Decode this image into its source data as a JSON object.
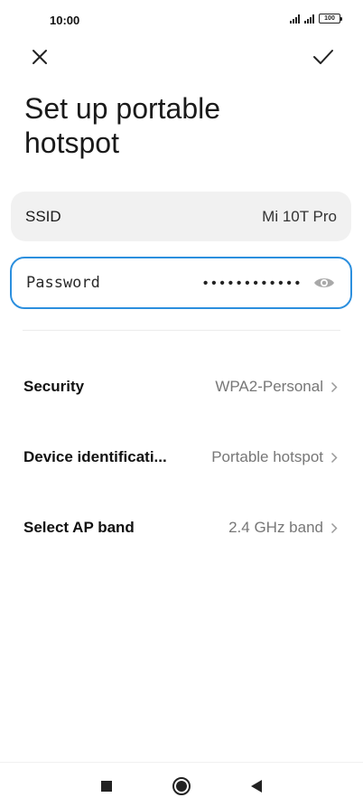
{
  "status_bar": {
    "time": "10:00",
    "battery": "100"
  },
  "header": {
    "close_icon": "close-icon",
    "confirm_icon": "check-icon",
    "title_line1": "Set up portable",
    "title_line2": "hotspot"
  },
  "ssid": {
    "label": "SSID",
    "value": "Mi 10T Pro"
  },
  "password": {
    "label": "Password",
    "masked_value": "••••••••••••",
    "visibility_icon": "eye-icon"
  },
  "settings": [
    {
      "label": "Security",
      "value": "WPA2-Personal"
    },
    {
      "label": "Device identificati...",
      "value": "Portable hotspot"
    },
    {
      "label": "Select AP band",
      "value": "2.4 GHz band"
    }
  ],
  "colors": {
    "accent": "#2c8fde",
    "card_bg": "#f1f1f1",
    "secondary_text": "#777777"
  },
  "nav": {
    "recent_icon": "square-icon",
    "home_icon": "circle-icon",
    "back_icon": "triangle-back-icon"
  }
}
